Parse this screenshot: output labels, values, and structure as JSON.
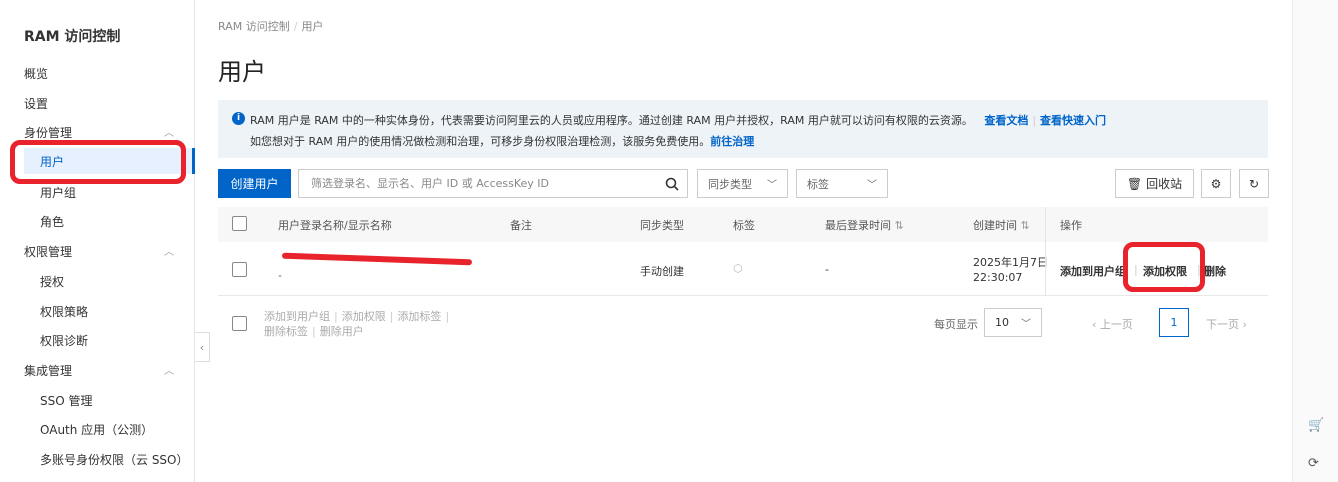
{
  "sidebar": {
    "title": "RAM 访问控制",
    "overview": "概览",
    "settings": "设置",
    "identity_group": "身份管理",
    "users": "用户",
    "user_groups": "用户组",
    "roles": "角色",
    "permission_group": "权限管理",
    "grants": "授权",
    "policies": "权限策略",
    "diagnostics": "权限诊断",
    "integration_group": "集成管理",
    "sso": "SSO 管理",
    "oauth": "OAuth 应用（公测）",
    "multi_account": "多账号身份权限（云 SSO）"
  },
  "breadcrumb": {
    "root": "RAM 访问控制",
    "sep": "/",
    "current": "用户"
  },
  "page_title": "用户",
  "notice": {
    "line1": "RAM 用户是 RAM 中的一种实体身份，代表需要访问阿里云的人员或应用程序。通过创建 RAM 用户并授权，RAM 用户就可以访问有权限的云资源。",
    "link_docs": "查看文档",
    "link_quickstart": "查看快速入门",
    "line2": "如您想对于 RAM 用户的使用情况做检测和治理，可移步身份权限治理检测，该服务免费使用。",
    "link_governance": "前往治理"
  },
  "toolbar": {
    "create_user": "创建用户",
    "search_placeholder": "筛选登录名、显示名、用户 ID 或 AccessKey ID",
    "sync_type": "同步类型",
    "tags": "标签",
    "recycle_bin": "回收站"
  },
  "table": {
    "headers": {
      "login_name": "用户登录名称/显示名称",
      "note": "备注",
      "sync_type": "同步类型",
      "tags": "标签",
      "last_login": "最后登录时间",
      "created": "创建时间",
      "actions": "操作"
    },
    "rows": [
      {
        "display_name": "-",
        "sync_type": "手动创建",
        "last_login": "-",
        "created_date": "2025年1月7日",
        "created_time": "22:30:07",
        "action_add_group": "添加到用户组",
        "action_add_permission": "添加权限",
        "action_delete": "删除"
      }
    ]
  },
  "bulk_actions": {
    "add_to_group": "添加到用户组",
    "add_permission": "添加权限",
    "add_tag": "添加标签",
    "delete_tag": "删除标签",
    "delete_user": "删除用户"
  },
  "pagination": {
    "page_size_label": "每页显示",
    "page_size": "10",
    "prev": "上一页",
    "current": "1",
    "next": "下一页"
  },
  "colors": {
    "primary": "#0064c8",
    "highlight": "#e8232b"
  }
}
